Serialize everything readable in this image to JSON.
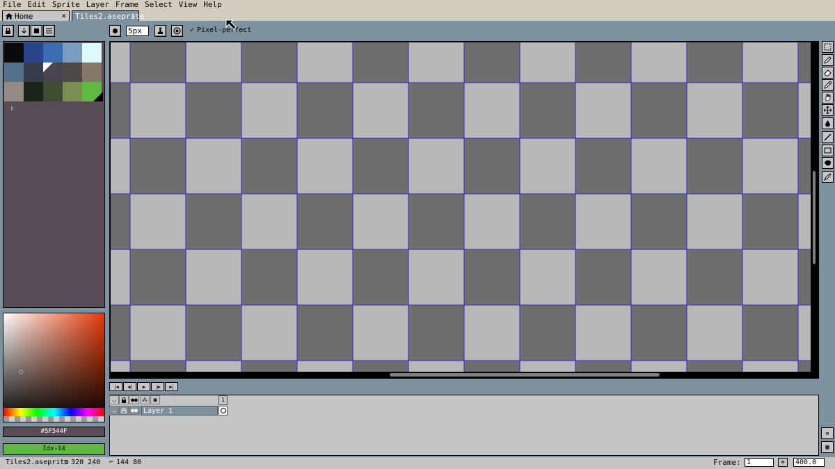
{
  "menu": [
    "File",
    "Edit",
    "Sprite",
    "Layer",
    "Frame",
    "Select",
    "View",
    "Help"
  ],
  "tabs": {
    "home": {
      "label": "Home",
      "icon": "home-icon",
      "close": "✕"
    },
    "file": {
      "label": "Tiles2.aseprite",
      "close": "✕"
    }
  },
  "toolbar": {
    "brush_size": "5px",
    "pixel_perfect_label": "Pixel-perfect",
    "pixel_perfect_checked": "✓"
  },
  "palette": {
    "colors": [
      "#0a0a0a",
      "#28458c",
      "#3b6cb1",
      "#7a9cc0",
      "#ddf9fb",
      "#56728b",
      "#353c4c",
      "#4a4450",
      "#4d4947",
      "#857869",
      "#968a84",
      "#1a2519",
      "#3f4b32",
      "#7c8e53",
      "#5cbb3f"
    ]
  },
  "color": {
    "hex": "#5F544F",
    "index": "Idx-14"
  },
  "canvas": {
    "light_tile": "#b8b8b8",
    "dark_tile": "#6e6e6e",
    "grid_color": "#2a2acc"
  },
  "timeline": {
    "frame_number": "1",
    "layer_name": "Layer 1"
  },
  "status": {
    "filename": "Tiles2.aseprite",
    "sprite_size": "320 240",
    "cursor_pos": "144 80",
    "frame_label": "Frame:",
    "frame_value": "1",
    "plus": "+",
    "zoom": "400.0"
  }
}
